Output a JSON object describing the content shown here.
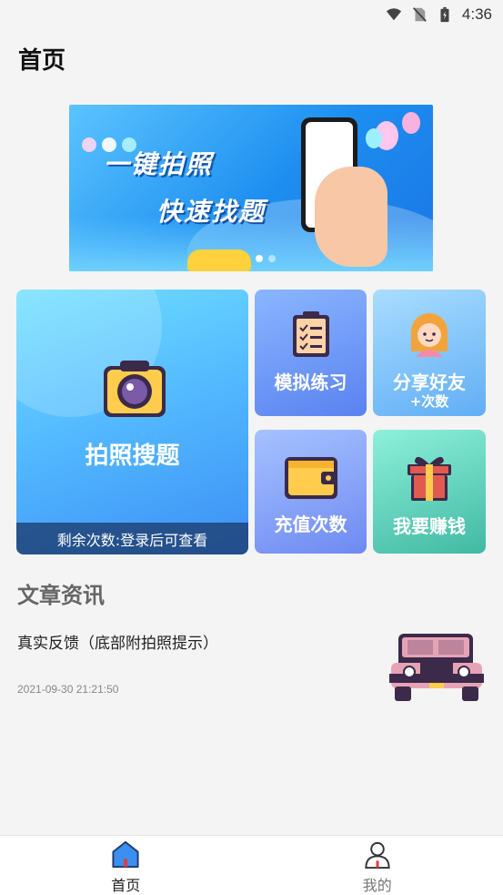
{
  "status_bar": {
    "time": "4:36",
    "icons": [
      "wifi-icon",
      "no-sim-icon",
      "battery-icon"
    ]
  },
  "header": {
    "title": "首页"
  },
  "banner": {
    "line1": "一键拍照",
    "line2": "快速找题",
    "slide_count": 2,
    "active_slide": 1
  },
  "tiles": {
    "photo_search": {
      "label": "拍照搜题",
      "footer": "剩余次数:登录后可查看",
      "icon": "camera-icon"
    },
    "simulate": {
      "label": "模拟练习",
      "icon": "clipboard-icon"
    },
    "share": {
      "label": "分享好友",
      "sub": "+次数",
      "icon": "girl-avatar-icon"
    },
    "recharge": {
      "label": "充值次数",
      "icon": "wallet-icon"
    },
    "earn": {
      "label": "我要赚钱",
      "icon": "gift-icon"
    }
  },
  "articles": {
    "section_title": "文章资讯",
    "items": [
      {
        "title": "真实反馈（底部附拍照提示）",
        "date": "2021-09-30 21:21:50",
        "thumb_icon": "pink-jeep-icon"
      }
    ]
  },
  "bottom_nav": {
    "items": [
      {
        "label": "首页",
        "icon": "home-icon",
        "active": true
      },
      {
        "label": "我的",
        "icon": "user-icon",
        "active": false
      }
    ]
  },
  "colors": {
    "accent_blue": "#3c8ff4",
    "background": "#f4f4f4"
  }
}
